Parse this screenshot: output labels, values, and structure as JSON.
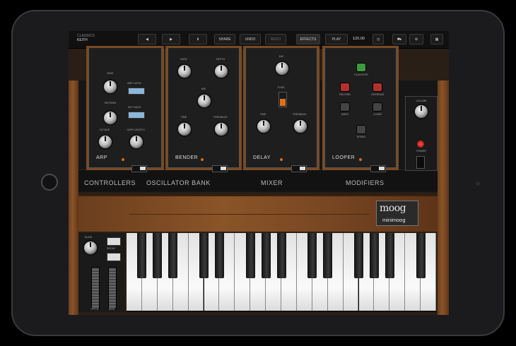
{
  "preset": {
    "label": "CLASSICS",
    "name": "KEITH"
  },
  "toolbar": {
    "prev_label": "◀",
    "next_label": "▶",
    "save_label": "⬇",
    "share_label": "SHARE",
    "undo_label": "UNDO",
    "redo_label": "REDO",
    "effects_label": "EFFECTS",
    "play_label": "PLAY",
    "tempo": "120.00"
  },
  "modules": {
    "arp": {
      "title": "ARP",
      "rate": "RATE",
      "pattern": "PATTERN",
      "octave": "OCTAVE",
      "latch": "ARP LATCH",
      "key_hold": "KEY HOLD",
      "gate": "GATE LENGTH"
    },
    "bender": {
      "title": "BENDER",
      "rate": "RATE",
      "depth": "DEPTH",
      "mix": "MIX",
      "time": "TIME",
      "feedback": "FEEDBACK"
    },
    "delay": {
      "title": "DELAY",
      "mix": "MIX",
      "sync": "SYNC",
      "time": "TIME",
      "feedback": "FEEDBACK"
    },
    "looper": {
      "title": "LOOPER",
      "play_stop": "PLAY/STOP",
      "record": "RECORD",
      "overdub": "OVERDUB",
      "undo": "UNDO",
      "clear": "CLEAR",
      "speed": "SPEED"
    }
  },
  "sections": {
    "controllers": "CONTROLLERS",
    "osc_bank": "OSCILLATOR BANK",
    "mixer": "MIXER",
    "modifiers": "MODIFIERS"
  },
  "output": {
    "volume": "VOLUME",
    "power": "POWER"
  },
  "logo": {
    "brand": "moog",
    "model": "minimoog"
  },
  "wheels": {
    "pitch": "PITCH",
    "mod": "MOD",
    "glide": "GLIDE",
    "decay": "DECAY"
  },
  "colors": {
    "wood": "#8a5428",
    "panel": "#1e1e1e",
    "accent_orange": "#d86a10",
    "led_red": "#e02020"
  }
}
